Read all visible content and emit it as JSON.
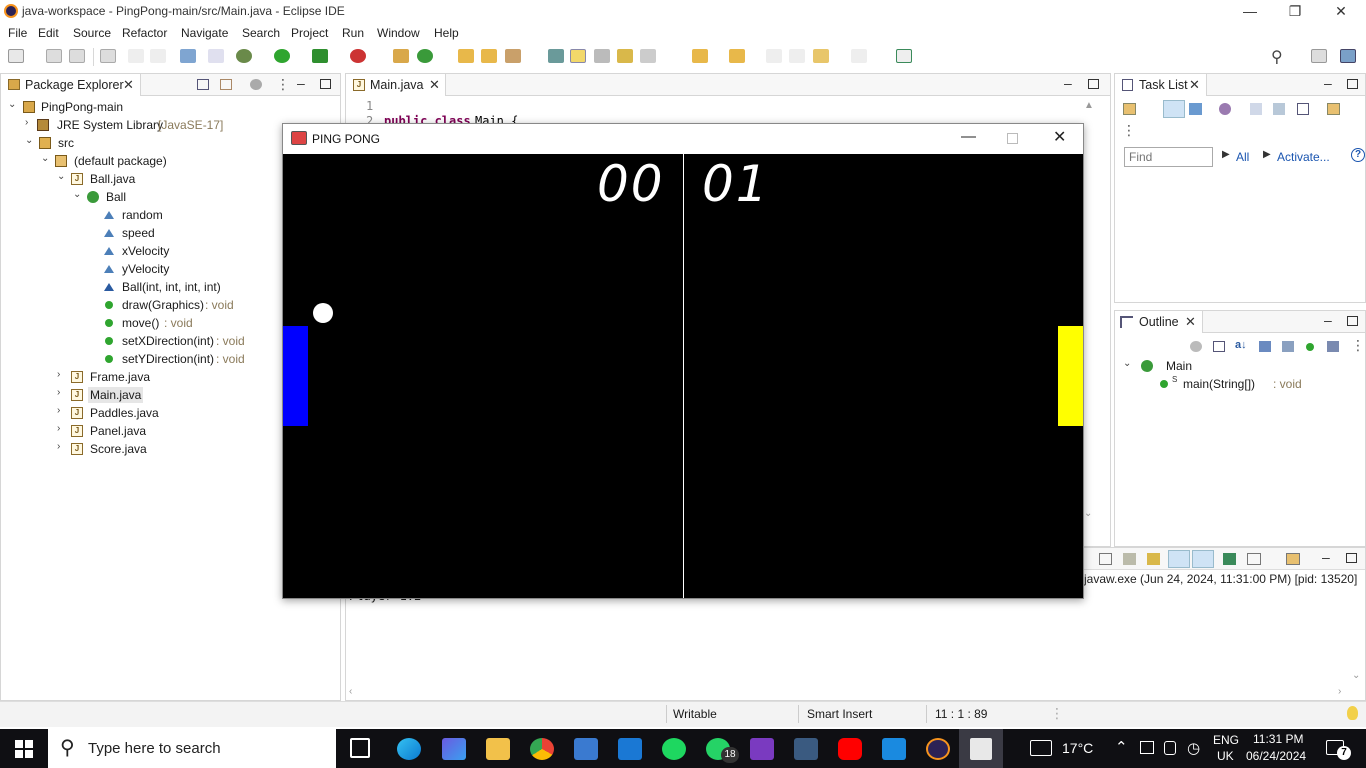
{
  "window": {
    "title": "java-workspace - PingPong-main/src/Main.java - Eclipse IDE"
  },
  "menu": [
    "File",
    "Edit",
    "Source",
    "Refactor",
    "Navigate",
    "Search",
    "Project",
    "Run",
    "Window",
    "Help"
  ],
  "package_explorer": {
    "tab_label": "Package Explorer",
    "tree": {
      "project": "PingPong-main",
      "jre": "JRE System Library",
      "jre_version": "[JavaSE-17]",
      "src": "src",
      "package": "(default package)",
      "ball_file": "Ball.java",
      "ball_class": "Ball",
      "fields": [
        "random",
        "speed",
        "xVelocity",
        "yVelocity"
      ],
      "constructor": "Ball(int, int, int, int)",
      "methods": [
        {
          "name": "draw(Graphics)",
          "type": ": void"
        },
        {
          "name": "move()",
          "type": ": void"
        },
        {
          "name": "setXDirection(int)",
          "type": ": void"
        },
        {
          "name": "setYDirection(int)",
          "type": ": void"
        }
      ],
      "files": [
        "Frame.java",
        "Main.java",
        "Paddles.java",
        "Panel.java",
        "Score.java"
      ]
    }
  },
  "editor": {
    "tab_label": "Main.java",
    "line_numbers": [
      "1",
      "2"
    ],
    "line2_keywords": "public class",
    "line2_name": "Main {"
  },
  "task_list": {
    "tab_label": "Task List",
    "find_placeholder": "Find",
    "all_label": "All",
    "activate_label": "Activate..."
  },
  "outline": {
    "tab_label": "Outline",
    "class_name": "Main",
    "method_name": "main(String[])",
    "method_type": ": void"
  },
  "console": {
    "launch_info": "javaw.exe  (Jun 24, 2024, 11:31:00 PM) [pid: 13520]",
    "output_fragment": "Player 1:2"
  },
  "pong": {
    "title": "PING PONG",
    "score_left": "00",
    "score_right": "01",
    "colors": {
      "background": "#000000",
      "left_paddle": "#0000ff",
      "right_paddle": "#ffff00",
      "ball": "#ffffff",
      "line": "#ffffff"
    }
  },
  "status": {
    "writable": "Writable",
    "insert_mode": "Smart Insert",
    "position": "11 : 1 : 89"
  },
  "taskbar": {
    "search_placeholder": "Type here to search",
    "whatsapp_badge": "18",
    "weather": "17°C",
    "lang_top": "ENG",
    "lang_bottom": "UK",
    "time": "11:31 PM",
    "date": "06/24/2024",
    "notification_count": "7"
  }
}
